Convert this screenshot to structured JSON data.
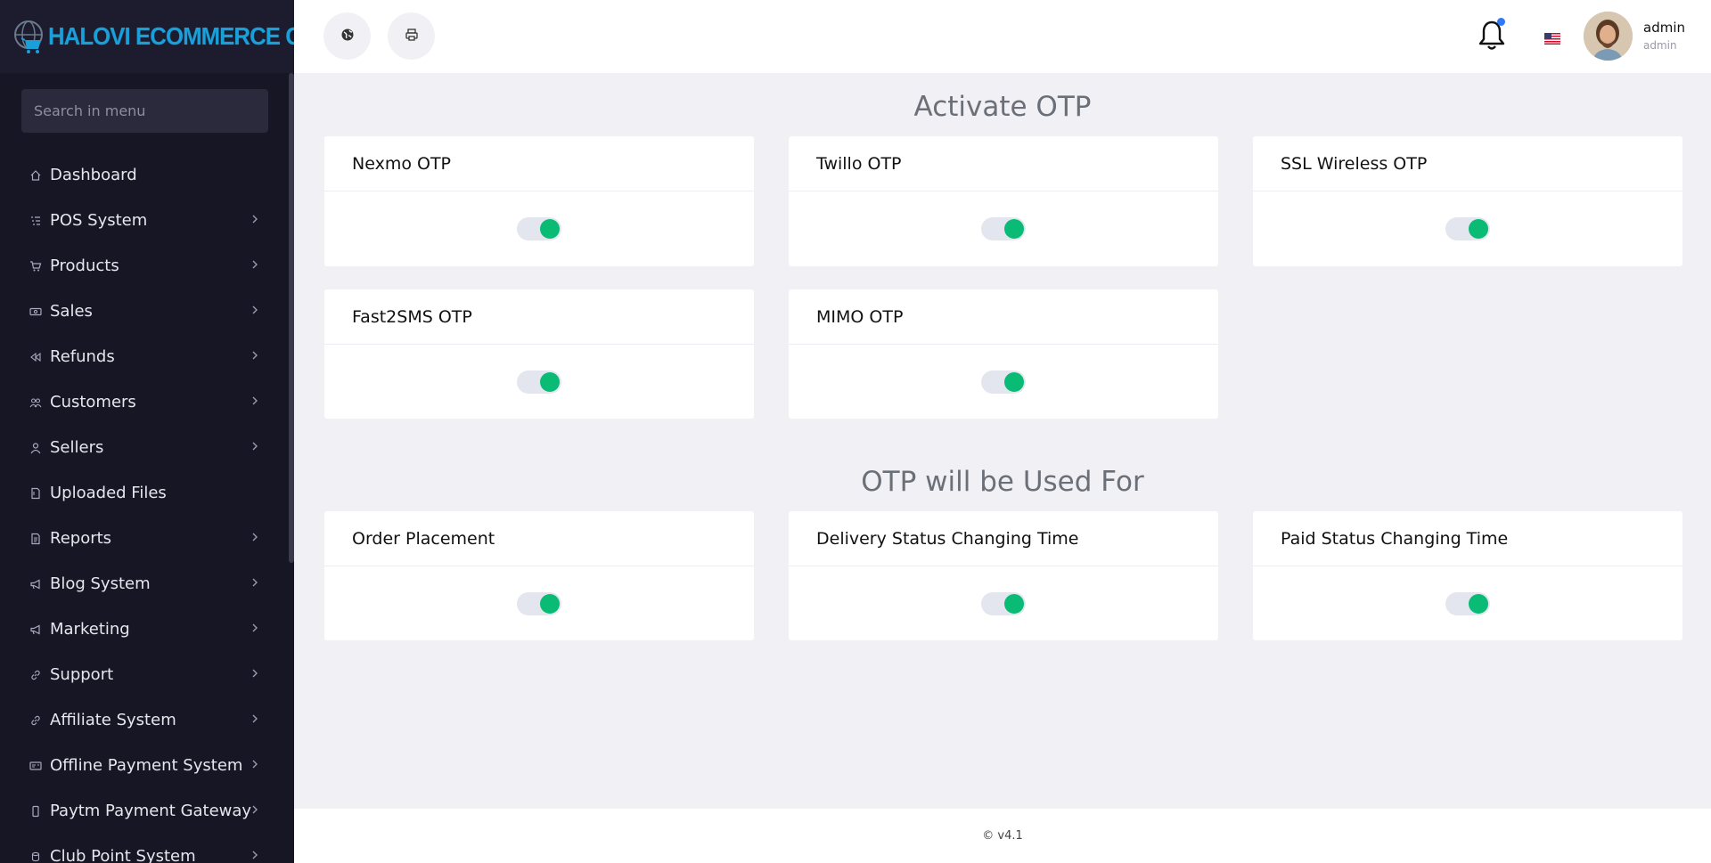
{
  "brand": {
    "name": "HALOVI ECOMMERCE CMS"
  },
  "search": {
    "placeholder": "Search in menu"
  },
  "sidebar": {
    "items": [
      {
        "label": "Dashboard",
        "icon": "home-icon",
        "chevron": false
      },
      {
        "label": "POS System",
        "icon": "list-icon",
        "chevron": true
      },
      {
        "label": "Products",
        "icon": "cart-icon",
        "chevron": true
      },
      {
        "label": "Sales",
        "icon": "money-icon",
        "chevron": true
      },
      {
        "label": "Refunds",
        "icon": "backward-icon",
        "chevron": true
      },
      {
        "label": "Customers",
        "icon": "users-icon",
        "chevron": true
      },
      {
        "label": "Sellers",
        "icon": "user-icon",
        "chevron": true
      },
      {
        "label": "Uploaded Files",
        "icon": "folder-icon",
        "chevron": false
      },
      {
        "label": "Reports",
        "icon": "report-icon",
        "chevron": true
      },
      {
        "label": "Blog System",
        "icon": "bullhorn-icon",
        "chevron": true
      },
      {
        "label": "Marketing",
        "icon": "bullhorn-icon",
        "chevron": true
      },
      {
        "label": "Support",
        "icon": "link-icon",
        "chevron": true
      },
      {
        "label": "Affiliate System",
        "icon": "link-icon",
        "chevron": true
      },
      {
        "label": "Offline Payment System",
        "icon": "card-icon",
        "chevron": true
      },
      {
        "label": "Paytm Payment Gateway",
        "icon": "mobile-icon",
        "chevron": true
      },
      {
        "label": "Club Point System",
        "icon": "coin-icon",
        "chevron": true
      }
    ]
  },
  "topbar": {
    "notification_dot": true,
    "language_flag": "us-flag-icon",
    "user": {
      "name": "admin",
      "role": "admin"
    }
  },
  "sections": {
    "activate": {
      "title": "Activate OTP",
      "cards": [
        {
          "label": "Nexmo OTP",
          "enabled": true
        },
        {
          "label": "Twillo OTP",
          "enabled": true
        },
        {
          "label": "SSL Wireless OTP",
          "enabled": true
        },
        {
          "label": "Fast2SMS OTP",
          "enabled": true
        },
        {
          "label": "MIMO OTP",
          "enabled": true
        }
      ]
    },
    "usage": {
      "title": "OTP will be Used For",
      "cards": [
        {
          "label": "Order Placement",
          "enabled": true
        },
        {
          "label": "Delivery Status Changing Time",
          "enabled": true
        },
        {
          "label": "Paid Status Changing Time",
          "enabled": true
        }
      ]
    }
  },
  "footer": {
    "version": "© v4.1"
  },
  "colors": {
    "sidebar": "#161624",
    "accent": "#0abb75",
    "notification": "#2e79f5",
    "brand": "#1a9fd8"
  }
}
